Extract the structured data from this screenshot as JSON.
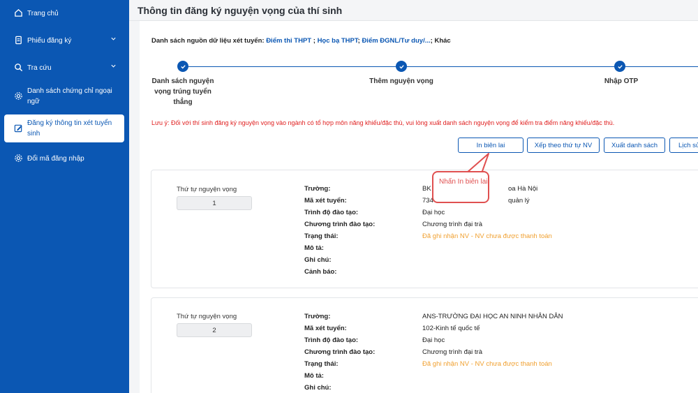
{
  "sidebar": {
    "items": [
      {
        "label": "Trang chủ",
        "icon": "home-icon"
      },
      {
        "label": "Phiếu đăng ký",
        "icon": "document-icon"
      },
      {
        "label": "Tra cứu",
        "icon": "search-icon"
      },
      {
        "label": "Danh sách chứng chỉ ngoại ngữ",
        "label_line1": "Danh sách chứng chỉ ngoại",
        "label_line2": "ngữ",
        "icon": "gear-icon"
      },
      {
        "label": "Đăng ký thông tin xét tuyển sinh",
        "label_line1": "Đăng ký thông tin xét tuyển",
        "label_line2": "sinh",
        "icon": "edit-icon",
        "active": true
      },
      {
        "label": "Đổi mã đăng nhập",
        "icon": "gear-icon"
      }
    ]
  },
  "header": {
    "title": "Thông tin đăng ký nguyện vọng của thí sinh"
  },
  "sources": {
    "prefix": "Danh sách nguồn dữ liệu xét tuyển:",
    "items": [
      "Điểm thi THPT",
      "Học bạ THPT",
      "Điểm ĐGNL/Tư duy/...",
      "Khác"
    ],
    "sep": ";"
  },
  "steps": [
    {
      "label_line1": "Danh sách nguyện",
      "label_line2": "vọng trúng tuyển",
      "label_line3": "thẳng"
    },
    {
      "label_line1": "Thêm nguyện vọng"
    },
    {
      "label_line1": "Nhập OTP"
    }
  ],
  "warning": "Lưu ý: Đối với thí sinh đăng ký nguyện vọng vào ngành có tổ hợp môn năng khiếu/đặc thù, vui lòng xuất danh sách nguyện vọng để kiểm tra điểm năng khiếu/đặc thù.",
  "toolbar": {
    "print": "In biên lai",
    "sort": "Xếp theo thứ tự NV",
    "export": "Xuất danh sách",
    "history": "Lịch sử"
  },
  "callout": {
    "text": "Nhấn In biên lai"
  },
  "field_labels": {
    "order": "Thứ tự nguyện vọng",
    "school": "Trường:",
    "code": "Mã xét tuyển:",
    "level": "Trình độ đào tạo:",
    "program": "Chương trình đào tạo:",
    "status": "Trạng thái:",
    "description": "Mô tả:",
    "note": "Ghi chú:",
    "alert": "Cảnh báo:"
  },
  "wishes": [
    {
      "order": "1",
      "school": "BK",
      "school_tail": "oa Hà Nội",
      "code": "734",
      "code_tail": "quản lý",
      "level": "Đại học",
      "program": "Chương trình đại trà",
      "status": "Đã ghi nhận NV - NV chưa được thanh toán"
    },
    {
      "order": "2",
      "school": "ANS-TRƯỜNG ĐẠI HỌC AN NINH NHÂN DÂN",
      "code": "102-Kinh tế quốc tế",
      "level": "Đại học",
      "program": "Chương trình đại trà",
      "status": "Đã ghi nhận NV - NV chưa được thanh toán"
    }
  ],
  "colors": {
    "primary": "#0b57b3",
    "warning": "#e02020",
    "status": "#f0a030",
    "callout": "#e05050"
  }
}
